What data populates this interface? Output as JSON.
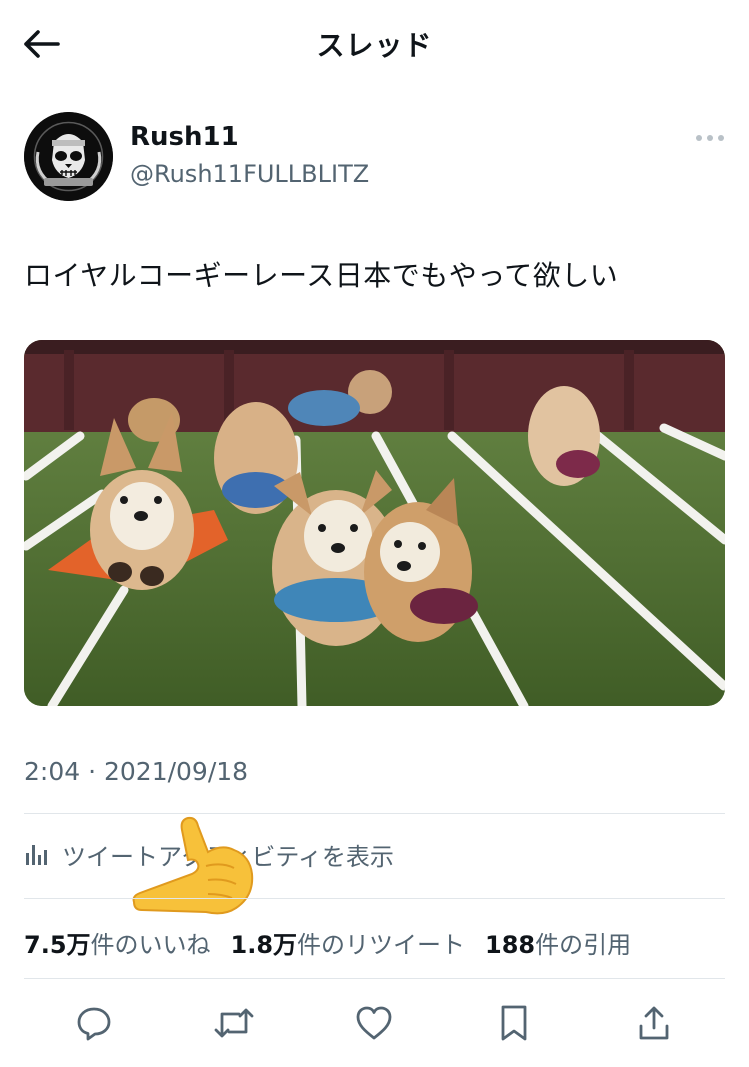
{
  "header": {
    "back_icon": "arrow-left-icon",
    "title": "スレッド"
  },
  "tweet": {
    "author": {
      "display_name": "Rush11",
      "handle": "@Rush11FULLBLITZ",
      "avatar_icon": "avatar-skull-icon"
    },
    "more_icon": "more-dots-icon",
    "text": "ロイヤルコーギーレース日本でもやって欲しい",
    "media": {
      "kind": "photo",
      "icon": "corgi-race-photo"
    },
    "timestamp": "2:04 · 2021/09/18"
  },
  "analytics": {
    "icon": "bar-chart-icon",
    "label": "ツイートアクティビティを表示"
  },
  "overlay": {
    "icon": "pointing-hand-emoji"
  },
  "stats": [
    {
      "number": "7.5万",
      "label": "件のいいね"
    },
    {
      "number": "1.8万",
      "label": "件のリツイート"
    },
    {
      "number": "188",
      "label": "件の引用"
    }
  ],
  "actions": [
    {
      "name": "reply",
      "icon": "reply-icon"
    },
    {
      "name": "retweet",
      "icon": "retweet-icon"
    },
    {
      "name": "like",
      "icon": "heart-icon"
    },
    {
      "name": "bookmark",
      "icon": "bookmark-icon"
    },
    {
      "name": "share",
      "icon": "share-icon"
    }
  ],
  "colors": {
    "text_primary": "#0f1419",
    "text_secondary": "#536471",
    "divider": "#e1e6ea"
  }
}
